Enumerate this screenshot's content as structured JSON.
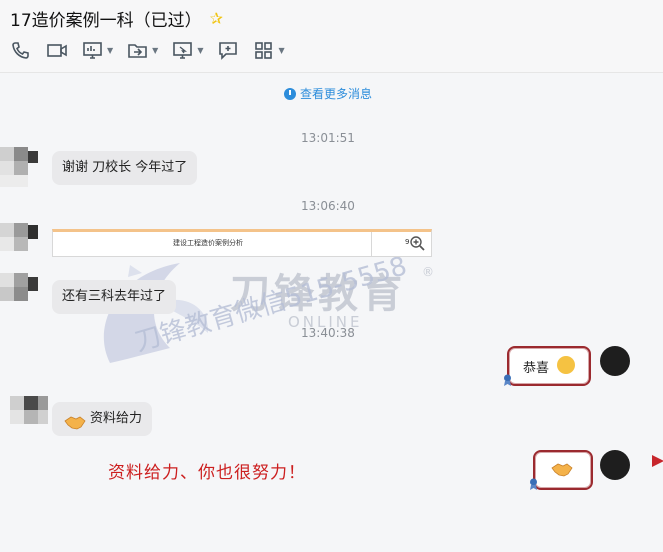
{
  "header": {
    "title": "17造价案例一科（已过）",
    "toolbar": [
      {
        "icon": "phone-icon"
      },
      {
        "icon": "video-icon"
      },
      {
        "icon": "screen-share-icon"
      },
      {
        "icon": "file-transfer-icon"
      },
      {
        "icon": "remote-desktop-icon"
      },
      {
        "icon": "add-app-icon"
      },
      {
        "icon": "apps-grid-icon"
      }
    ]
  },
  "chat": {
    "more_messages": "查看更多消息",
    "timestamps": [
      "13:01:51",
      "13:06:40",
      "13:40:38"
    ],
    "messages": [
      {
        "side": "left",
        "text": "谢谢 刀校长    今年过了"
      },
      {
        "side": "left",
        "type": "file",
        "file_name": "建设工程造价案例分析",
        "file_suffix": "9"
      },
      {
        "side": "left",
        "text": "还有三科去年过了"
      },
      {
        "side": "right",
        "text": "恭喜"
      },
      {
        "side": "left",
        "text": "资料给力"
      },
      {
        "side": "right",
        "text": ""
      }
    ],
    "annotation": "资料给力、你也很努力！"
  },
  "watermark": {
    "brand": "刀锋教育",
    "registered": "®",
    "online": "ONLINE",
    "diagonal": "刀锋教育微信515-5558"
  },
  "colors": {
    "link": "#2d8ddb",
    "annotation": "#cc1f1f",
    "bubble_border": "#9b2a2f"
  }
}
